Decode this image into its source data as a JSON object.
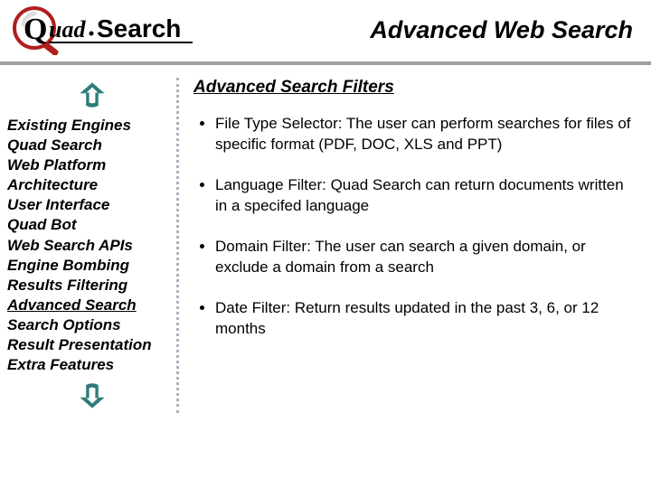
{
  "header": {
    "logo_text_italic": "uad",
    "logo_text_remainder": "Search",
    "title": "Advanced Web Search"
  },
  "sidebar": {
    "items": [
      {
        "label": "Existing Engines",
        "current": false
      },
      {
        "label": "Quad Search",
        "current": false
      },
      {
        "label": "Web Platform",
        "current": false
      },
      {
        "label": "Architecture",
        "current": false
      },
      {
        "label": "User Interface",
        "current": false
      },
      {
        "label": "Quad Bot",
        "current": false
      },
      {
        "label": "Web Search APIs",
        "current": false
      },
      {
        "label": "Engine Bombing",
        "current": false
      },
      {
        "label": "Results Filtering",
        "current": false
      },
      {
        "label": "Advanced Search",
        "current": true
      },
      {
        "label": "Search Options",
        "current": false
      },
      {
        "label": "Result Presentation",
        "current": false
      },
      {
        "label": "Extra Features",
        "current": false
      }
    ],
    "up_icon": "arrow-up-icon",
    "down_icon": "arrow-down-icon"
  },
  "main": {
    "section_title": "Advanced Search Filters",
    "bullets": [
      "File Type Selector: The user can perform searches for files of specific format (PDF, DOC, XLS and PPT)",
      "Language Filter: Quad Search can return documents written in a specifed language",
      "Domain Filter: The user can search a given domain, or exclude a domain from a search",
      "Date Filter: Return results updated in the past 3, 6, or 12 months"
    ]
  },
  "colors": {
    "accent_teal": "#2d7d7a",
    "logo_red": "#b01e1e"
  }
}
